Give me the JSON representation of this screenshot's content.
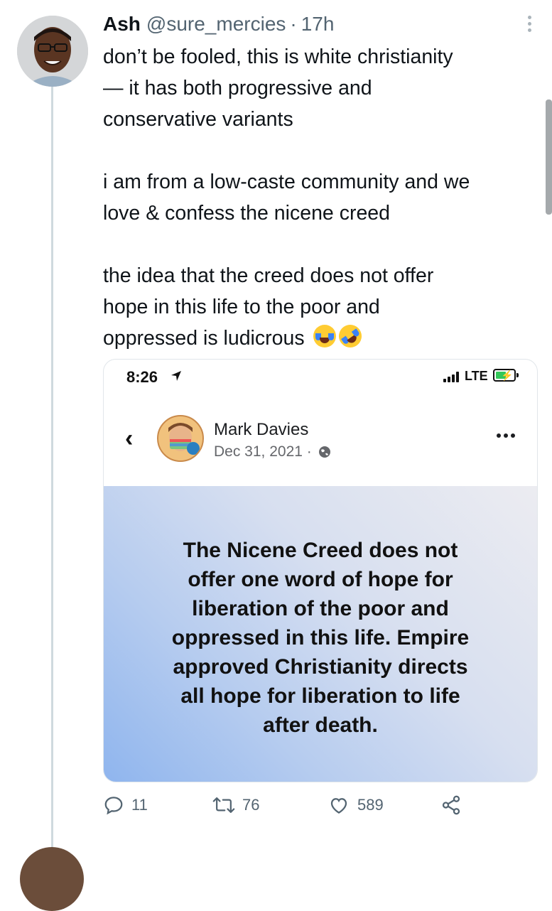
{
  "tweet": {
    "author_name": "Ash",
    "handle": "@sure_mercies",
    "separator": "·",
    "time": "17h",
    "lines": [
      "don’t be fooled, this is white christianity",
      "— it has both progressive and",
      "conservative variants",
      "",
      "i am from a low-caste community and we",
      "love & confess the nicene creed",
      "",
      "the idea that the creed does not offer",
      "hope in this life to the poor and",
      "oppressed is ludicrous"
    ],
    "emojis": [
      "face-with-tears-of-joy",
      "rolling-on-floor-laughing"
    ]
  },
  "embedded": {
    "status_time": "8:26",
    "network": "LTE",
    "post_author": "Mark Davies",
    "post_date": "Dec 31, 2021 ·",
    "post_text": [
      "The Nicene Creed does not",
      "offer one word of hope for",
      "liberation of the poor and",
      "oppressed in this life. Empire",
      "approved Christianity directs",
      "all hope for liberation to life",
      "after death."
    ]
  },
  "actions": {
    "replies": "11",
    "retweets": "76",
    "likes": "589"
  },
  "icons": [
    "more-vertical-icon",
    "location-arrow-icon",
    "signal-icon",
    "battery-icon",
    "back-chevron-icon",
    "globe-icon",
    "more-horizontal-icon",
    "reply-icon",
    "retweet-icon",
    "like-icon",
    "share-icon"
  ],
  "colors": {
    "text": "#0f1419",
    "secondary": "#536471",
    "thread_line": "#cfd9de",
    "post_bg_blue": "#8fb5ee"
  }
}
